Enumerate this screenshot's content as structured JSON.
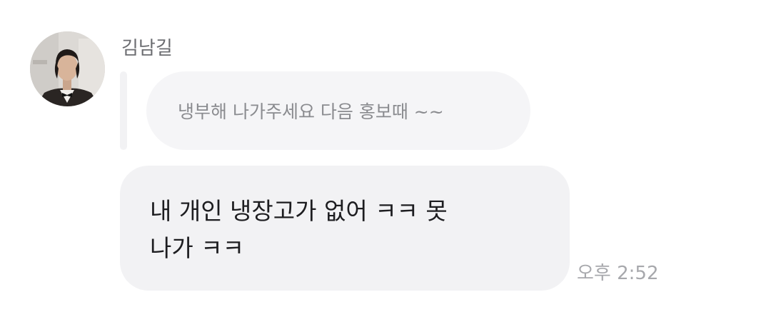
{
  "message": {
    "sender_name": "김남길",
    "avatar_icon": "profile-photo",
    "reply_quote": "냉부해 나가주세요 다음 홍보때 ~~",
    "text": "내 개인 냉장고가 없어 ㅋㅋ 못\n나가 ㅋㅋ",
    "timestamp": "오후 2:52"
  },
  "colors": {
    "bubble_bg": "#f2f2f4",
    "quote_bg": "#f5f5f7",
    "name_text": "#6b6c70",
    "quote_text": "#8a8b8f",
    "message_text": "#1d1d20",
    "time_text": "#a7a8ac"
  }
}
